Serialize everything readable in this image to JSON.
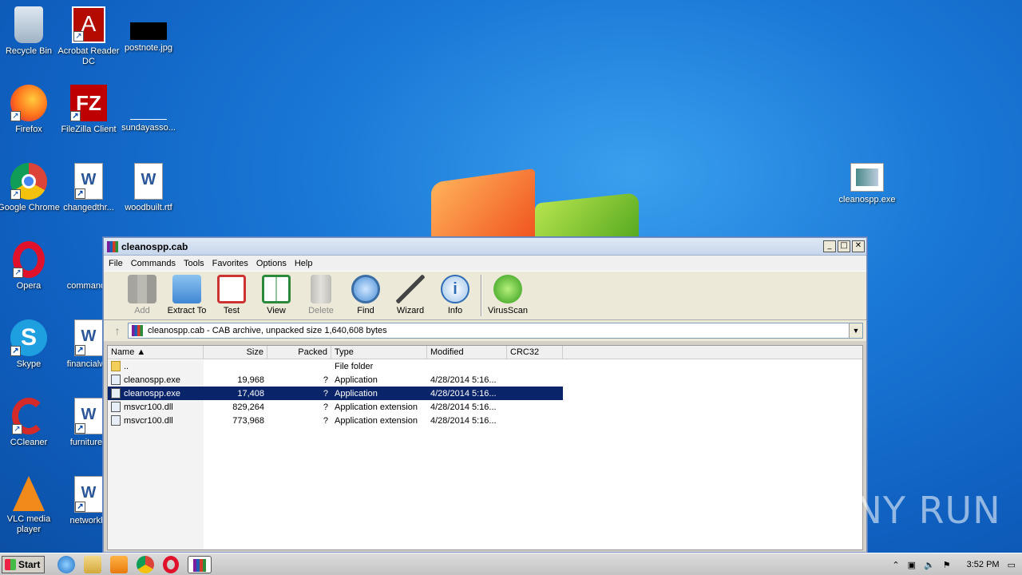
{
  "desktop": {
    "icons": [
      {
        "label": "Recycle Bin"
      },
      {
        "label": "Acrobat Reader DC"
      },
      {
        "label": "postnote.jpg"
      },
      {
        "label": "Firefox"
      },
      {
        "label": "FileZilla Client"
      },
      {
        "label": "sundayasso..."
      },
      {
        "label": "Google Chrome"
      },
      {
        "label": "changedthr..."
      },
      {
        "label": "woodbuilt.rtf"
      },
      {
        "label": "Opera"
      },
      {
        "label": "commando"
      },
      {
        "label": "Skype"
      },
      {
        "label": "financialwe"
      },
      {
        "label": "CCleaner"
      },
      {
        "label": "furniturea"
      },
      {
        "label": "VLC media player"
      },
      {
        "label": "networkhi"
      },
      {
        "label": "cleanospp.exe"
      }
    ]
  },
  "window": {
    "title": "cleanospp.cab",
    "menu": [
      "File",
      "Commands",
      "Tools",
      "Favorites",
      "Options",
      "Help"
    ],
    "toolbar": [
      "Add",
      "Extract To",
      "Test",
      "View",
      "Delete",
      "Find",
      "Wizard",
      "Info",
      "VirusScan"
    ],
    "address": "cleanospp.cab - CAB archive, unpacked size 1,640,608 bytes",
    "columns": [
      "Name",
      "Size",
      "Packed",
      "Type",
      "Modified",
      "CRC32"
    ],
    "rows": [
      {
        "name": "..",
        "size": "",
        "packed": "",
        "type": "File folder",
        "modified": ""
      },
      {
        "name": "cleanospp.exe",
        "size": "19,968",
        "packed": "?",
        "type": "Application",
        "modified": "4/28/2014 5:16..."
      },
      {
        "name": "cleanospp.exe",
        "size": "17,408",
        "packed": "?",
        "type": "Application",
        "modified": "4/28/2014 5:16..."
      },
      {
        "name": "msvcr100.dll",
        "size": "829,264",
        "packed": "?",
        "type": "Application extension",
        "modified": "4/28/2014 5:16..."
      },
      {
        "name": "msvcr100.dll",
        "size": "773,968",
        "packed": "?",
        "type": "Application extension",
        "modified": "4/28/2014 5:16..."
      }
    ]
  },
  "taskbar": {
    "start": "Start",
    "clock": "3:52 PM"
  },
  "watermark": "ANY RUN"
}
